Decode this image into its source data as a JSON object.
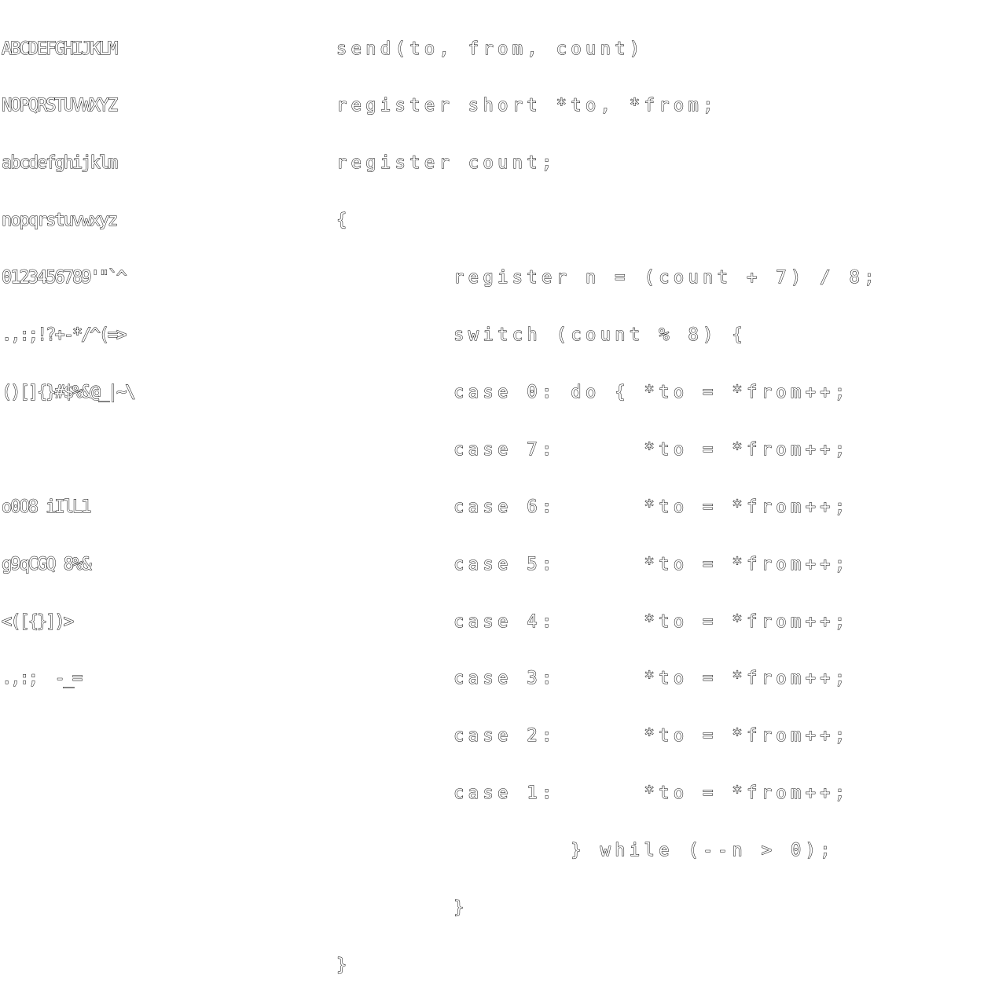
{
  "charset": {
    "lines": [
      "ABCDEFGHIJKLM",
      "NOPQRSTUVWXYZ",
      "abcdefghijklm",
      "nopqrstuvwxyz",
      "0123456789'\"`^",
      ".,:;!?+-*/^(=>",
      "()[]{}#$%&@_|~\\",
      "",
      "o0O8 iIlL1",
      "g9qCGQ 8%&",
      "<([{}])>",
      ".,:;  -_="
    ]
  },
  "code": {
    "lines": [
      "send(to, from, count)",
      "register short *to, *from;",
      "register count;",
      "{",
      "        register n = (count + 7) / 8;",
      "        switch (count % 8) {",
      "        case 0: do { *to = *from++;",
      "        case 7:      *to = *from++;",
      "        case 6:      *to = *from++;",
      "        case 5:      *to = *from++;",
      "        case 4:      *to = *from++;",
      "        case 3:      *to = *from++;",
      "        case 2:      *to = *from++;",
      "        case 1:      *to = *from++;",
      "                } while (--n > 0);",
      "        }",
      "}"
    ]
  }
}
